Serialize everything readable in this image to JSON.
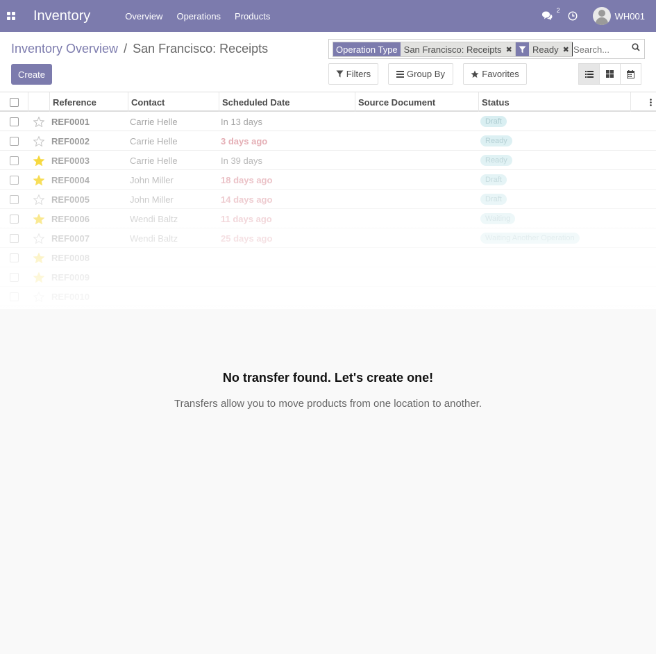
{
  "navbar": {
    "app_title": "Inventory",
    "menu": [
      "Overview",
      "Operations",
      "Products"
    ],
    "messages_count": "2",
    "user_name": "WH001",
    "color": "#7c7bad"
  },
  "breadcrumb": {
    "parent": "Inventory Overview",
    "separator": "/",
    "current": "San Francisco: Receipts"
  },
  "buttons": {
    "create": "Create",
    "filters": "Filters",
    "group_by": "Group By",
    "favorites": "Favorites"
  },
  "search": {
    "facets": [
      {
        "category": "Operation Type",
        "value": "San Francisco: Receipts"
      },
      {
        "category": "filter-icon",
        "value": "Ready"
      }
    ],
    "placeholder": "Search..."
  },
  "table": {
    "headers": [
      "Reference",
      "Contact",
      "Scheduled Date",
      "Source Document",
      "Status"
    ],
    "rows": [
      {
        "ref": "REF0001",
        "starred": false,
        "contact": "Carrie Helle",
        "date": "In 13 days",
        "late": false,
        "status": "Draft"
      },
      {
        "ref": "REF0002",
        "starred": false,
        "contact": "Carrie Helle",
        "date": "3 days ago",
        "late": true,
        "status": "Ready"
      },
      {
        "ref": "REF0003",
        "starred": true,
        "contact": "Carrie Helle",
        "date": "In 39 days",
        "late": false,
        "status": "Ready"
      },
      {
        "ref": "REF0004",
        "starred": true,
        "contact": "John Miller",
        "date": "18 days ago",
        "late": true,
        "status": "Draft"
      },
      {
        "ref": "REF0005",
        "starred": false,
        "contact": "John Miller",
        "date": "14 days ago",
        "late": true,
        "status": "Draft"
      },
      {
        "ref": "REF0006",
        "starred": true,
        "contact": "Wendi Baltz",
        "date": "11 days ago",
        "late": true,
        "status": "Waiting"
      },
      {
        "ref": "REF0007",
        "starred": false,
        "contact": "Wendi Baltz",
        "date": "25 days ago",
        "late": true,
        "status": "Waiting Another Operation"
      },
      {
        "ref": "REF0008",
        "starred": true,
        "contact": "",
        "date": "",
        "late": false,
        "status": ""
      },
      {
        "ref": "REF0009",
        "starred": true,
        "contact": "",
        "date": "",
        "late": false,
        "status": ""
      },
      {
        "ref": "REF0010",
        "starred": false,
        "contact": "",
        "date": "",
        "late": false,
        "status": ""
      }
    ]
  },
  "helper": {
    "title": "No transfer found. Let's create one!",
    "text": "Transfers allow you to move products from one location to another."
  }
}
